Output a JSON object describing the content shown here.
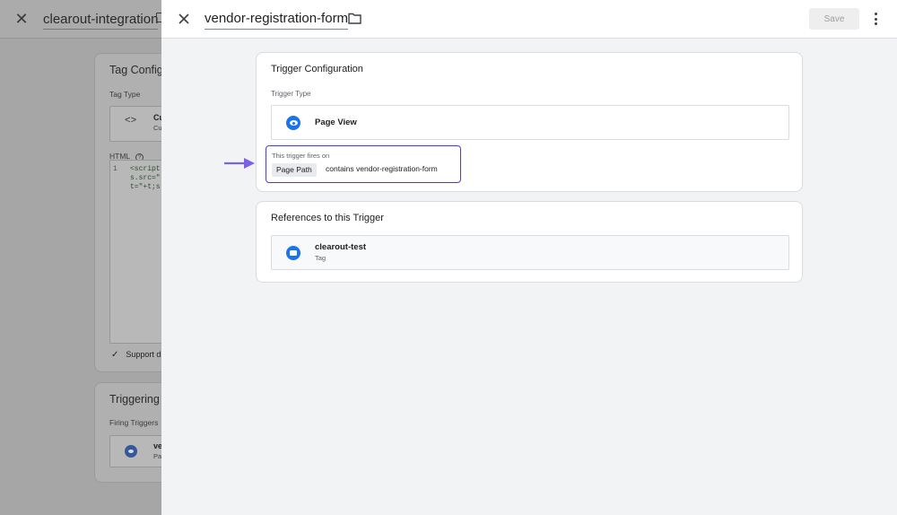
{
  "background_editor": {
    "title": "clearout-integration",
    "config_card_title": "Tag Configu",
    "tag_type_label": "Tag Type",
    "tag_type_icon": "code-icon",
    "tag_type_name": "Cu",
    "tag_type_sub": "Cu",
    "html_label": "HTML",
    "code_line_number": "1",
    "code_lines": [
      "<script",
      "s.src=\"",
      "t=\"+t;s"
    ],
    "support_label": "Support d",
    "triggering_title": "Triggering",
    "firing_triggers_label": "Firing Triggers",
    "trigger_name": "ve",
    "trigger_sub": "Pa"
  },
  "panel": {
    "title": "vendor-registration-form",
    "save_label": "Save"
  },
  "trigger_config": {
    "title": "Trigger Configuration",
    "type_label": "Trigger Type",
    "type_icon": "eye-icon",
    "type_name": "Page View",
    "fires_on_label": "This trigger fires on",
    "condition": {
      "variable": "Page Path",
      "operator": "contains",
      "value": "vendor-registration-form"
    }
  },
  "references": {
    "title": "References to this Trigger",
    "items": [
      {
        "name": "clearout-test",
        "type": "Tag",
        "icon": "tag-icon"
      }
    ]
  },
  "colors": {
    "accent": "#1a73e8",
    "highlight_border": "#4a3fc8",
    "arrow": "#7b61e8"
  }
}
